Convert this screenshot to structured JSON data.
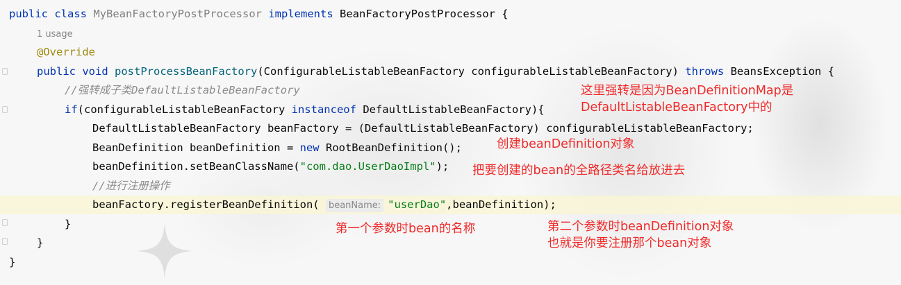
{
  "editor": {
    "colors": {
      "keyword": "#0033b3",
      "function": "#00627a",
      "annotation": "#9e880d",
      "string": "#067d17",
      "comment": "#8c8c8c",
      "annotation_note": "#f02a2a"
    },
    "code": {
      "l1_public": "public",
      "l1_class": "class",
      "l1_name": "MyBeanFactoryPostProcessor",
      "l1_implements": "implements",
      "l1_iface": "BeanFactoryPostProcessor {",
      "usage": "1 usage",
      "override": "@Override",
      "l4_public": "public",
      "l4_void": "void",
      "l4_method": "postProcessBeanFactory",
      "l4_params": "(ConfigurableListableBeanFactory configurableListableBeanFactory)",
      "l4_throws": "throws",
      "l4_exc": "BeansException {",
      "comment1": "//强转成子类DefaultListableBeanFactory",
      "l6_if": "if",
      "l6_cond_a": "(configurableListableBeanFactory",
      "l6_instanceof": "instanceof",
      "l6_cond_b": "DefaultListableBeanFactory){",
      "l7": "DefaultListableBeanFactory beanFactory = (DefaultListableBeanFactory) configurableListableBeanFactory;",
      "l8_a": "BeanDefinition beanDefinition =",
      "l8_new": "new",
      "l8_b": "RootBeanDefinition();",
      "l9_a": "beanDefinition.setBeanClassName(",
      "l9_str": "\"com.dao.UserDaoImpl\"",
      "l9_b": ");",
      "comment2": "//进行注册操作",
      "l11_a": "beanFactory.registerBeanDefinition(",
      "l11_hint": "beanName:",
      "l11_str": "\"userDao\"",
      "l11_b": ",beanDefinition);",
      "close1": "}",
      "close2": "}",
      "close3": "}"
    }
  },
  "annotations": {
    "n1_line1": "这里强转是因为BeanDefinitionMap是",
    "n1_line2": "DefaultListableBeanFactory中的",
    "n2": "创建beanDefinition对象",
    "n3": "把要创建的bean的全路径类名给放进去",
    "n4": "第一个参数时bean的名称",
    "n5_line1": "第二个参数时beanDefinition对象",
    "n5_line2": "也就是你要注册那个bean对象"
  }
}
